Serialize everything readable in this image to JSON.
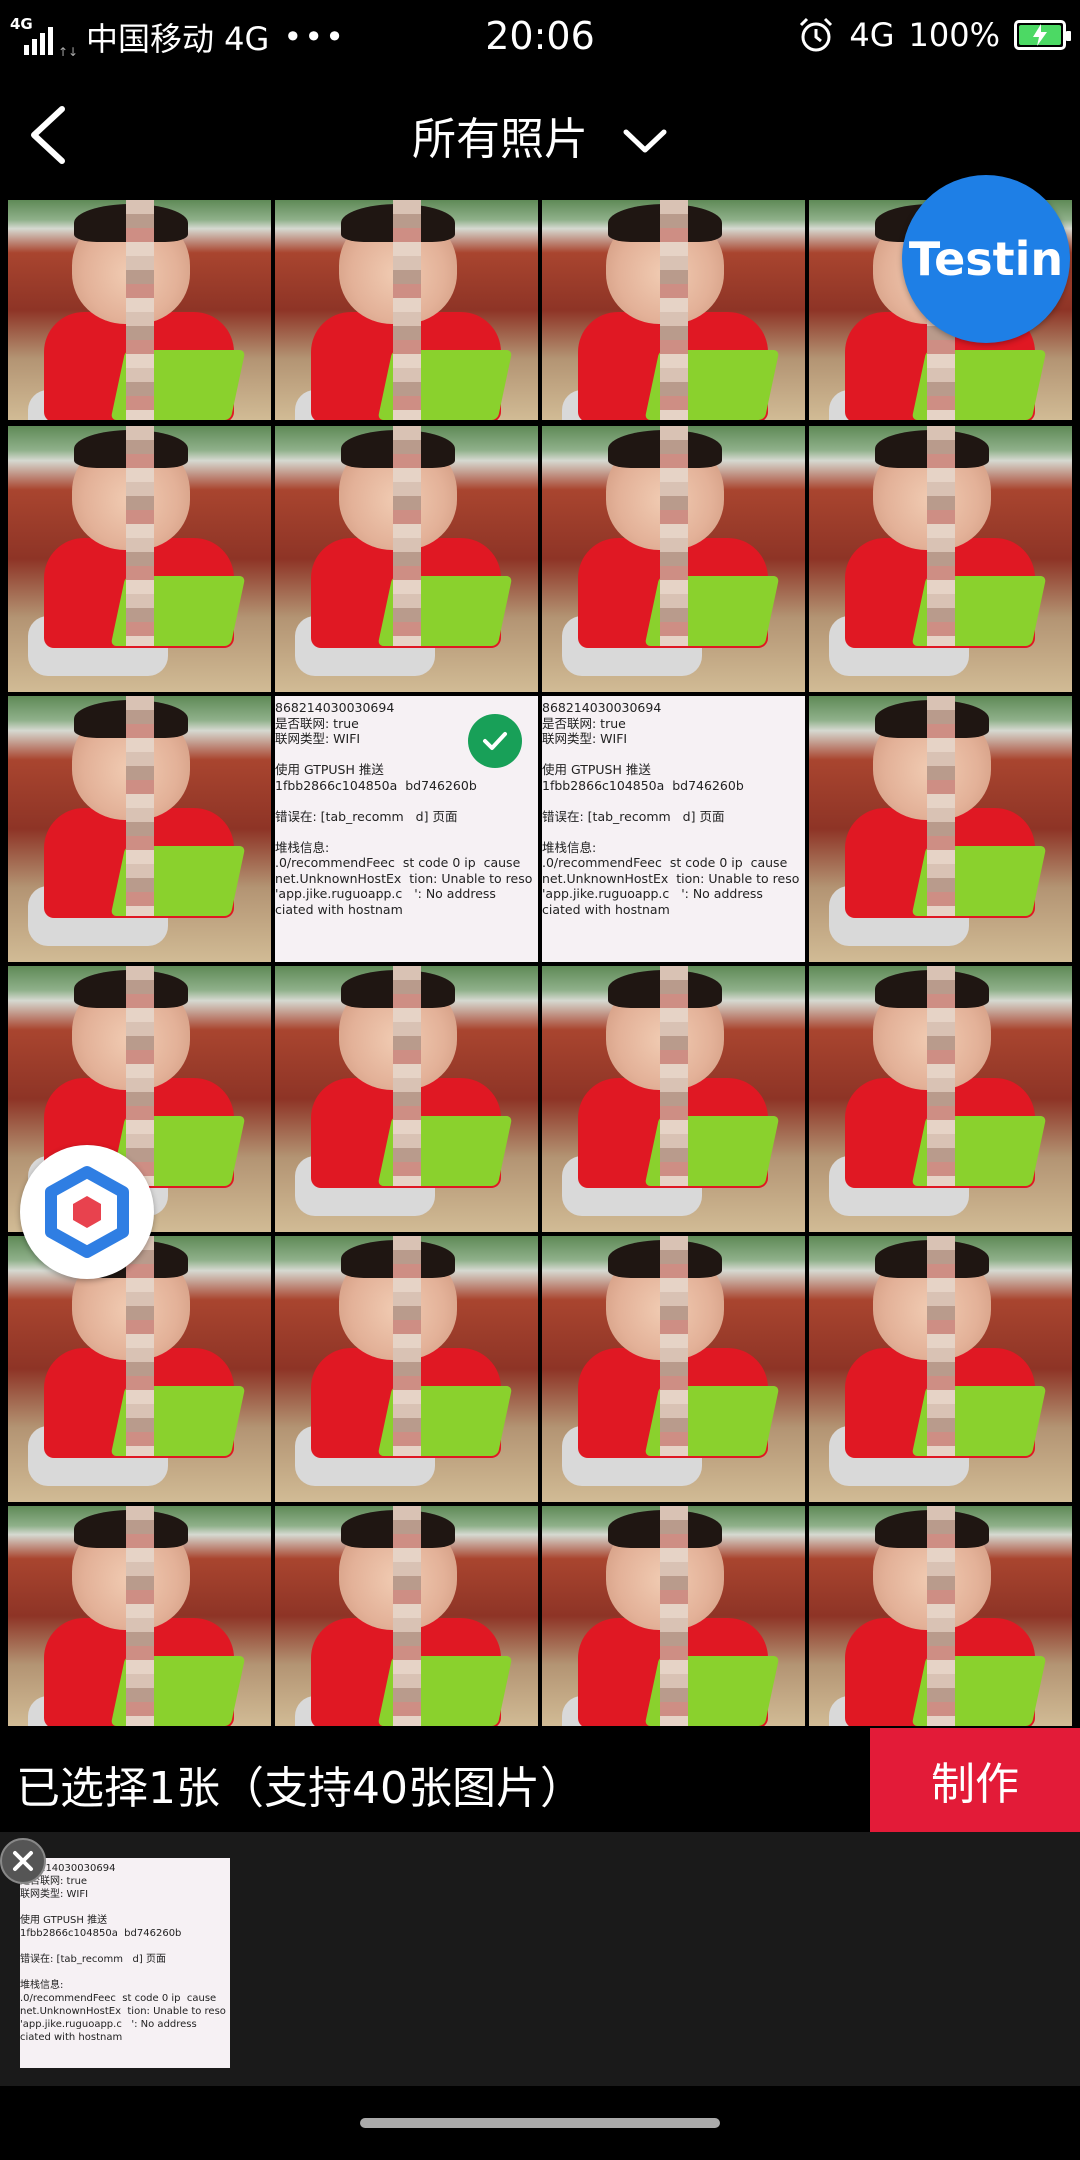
{
  "status_bar": {
    "network_tag": "4G",
    "carrier": "中国移动 4G",
    "more": "•••",
    "time": "20:06",
    "network_type": "4G",
    "battery": "100%"
  },
  "header": {
    "title": "所有照片"
  },
  "grid": {
    "rows": [
      [
        "photo",
        "photo",
        "photo",
        "photo"
      ],
      [
        "photo",
        "photo",
        "photo",
        "photo"
      ],
      [
        "photo",
        "screenshot",
        "screenshot",
        "photo"
      ],
      [
        "photo",
        "photo",
        "photo",
        "photo"
      ],
      [
        "photo",
        "photo",
        "photo",
        "photo"
      ],
      [
        "photo",
        "photo",
        "photo",
        "photo"
      ]
    ],
    "selected_index": 9
  },
  "screenshot_text": {
    "lines": [
      "868214030030694",
      "是否联网: true",
      "联网类型: WIFI",
      "",
      "使用 GTPUSH 推送",
      "1fbb2866c104850a  bd746260b",
      "",
      "错误在: [tab_recomm   d] 页面",
      "",
      "堆栈信息:",
      ".0/recommendFeec  st code 0 ip  cause",
      "net.UnknownHostEx  tion: Unable to reso",
      "'app.jike.ruguoapp.c   ': No address",
      "ciated with hostnam"
    ]
  },
  "floating": {
    "testin_label": "Testin"
  },
  "action_bar": {
    "selection_info": "已选择1张（支持40张图片）",
    "make_button": "制作"
  },
  "colors": {
    "accent_red": "#e31b38",
    "check_green": "#18a058",
    "testin_blue": "#1e7fe6"
  }
}
